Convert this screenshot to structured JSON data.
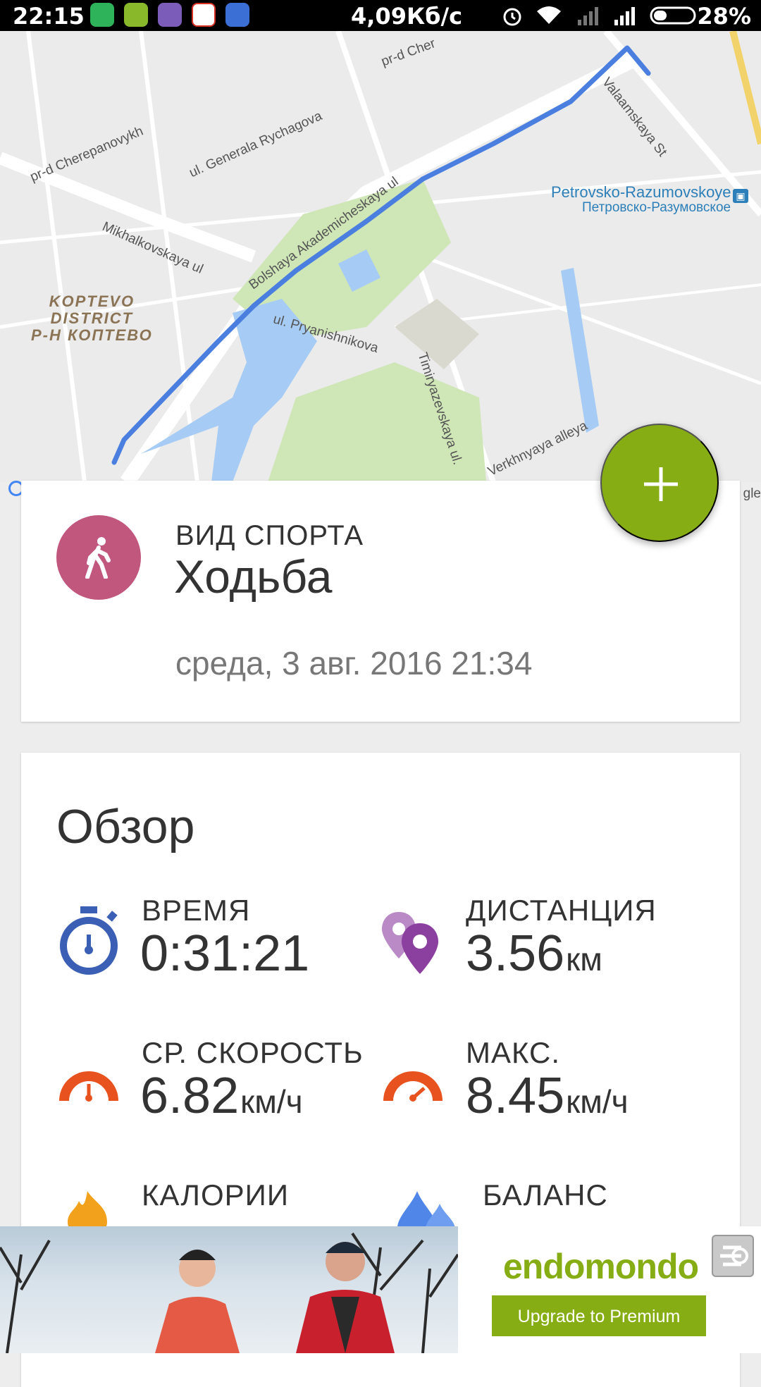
{
  "status_bar": {
    "time": "22:15",
    "network_speed": "4,09Кб/с",
    "battery": "28%"
  },
  "map": {
    "streets": [
      "pr-d Cherepanovykh",
      "ul. Generala Rychagova",
      "Mikhalkovskaya ul",
      "Bolshaya Akademicheskaya ul",
      "ul. Pryanishnikova",
      "Timiryazevskaya ul.",
      "Verkhnyaya alleya",
      "Valaamskaya St",
      "pr-d Cher"
    ],
    "district": [
      "KOPTEVO",
      "DISTRICT",
      "Р-Н КОПТЕВО"
    ],
    "metro_latin": "Petrovsko-Razumovskoye",
    "metro_cyrillic": "Петровско-Разумовское",
    "attribution": "gle",
    "route_color": "#4a7fe0"
  },
  "workout": {
    "sport_label": "ВИД СПОРТА",
    "sport_value": "Ходьба",
    "date": "среда, 3 авг. 2016 21:34",
    "sport_icon": "walking-person-icon",
    "sport_color": "#c1577c"
  },
  "fab": {
    "icon": "plus-icon",
    "color": "#86ad14"
  },
  "overview": {
    "title": "Обзор",
    "stats": [
      {
        "label": "ВРЕМЯ",
        "value": "0:31:21",
        "unit": "",
        "icon": "stopwatch-icon"
      },
      {
        "label": "ДИСТАНЦИЯ",
        "value": "3.56",
        "unit": "км",
        "icon": "map-pin-icon"
      },
      {
        "label": "СР. СКОРОСТЬ",
        "value": "6.82",
        "unit": "км/ч",
        "icon": "speedometer-icon"
      },
      {
        "label": "МАКС.",
        "value": "8.45",
        "unit": "км/ч",
        "icon": "speedometer-icon"
      },
      {
        "label": "КАЛОРИИ",
        "value": "",
        "unit": "",
        "icon": "flame-icon"
      },
      {
        "label": "БАЛАНС",
        "value": "",
        "unit": "",
        "icon": "water-drop-icon"
      }
    ]
  },
  "ad": {
    "brand": "endomondo",
    "button_label": "Upgrade to Premium",
    "brand_color": "#86ad14"
  }
}
